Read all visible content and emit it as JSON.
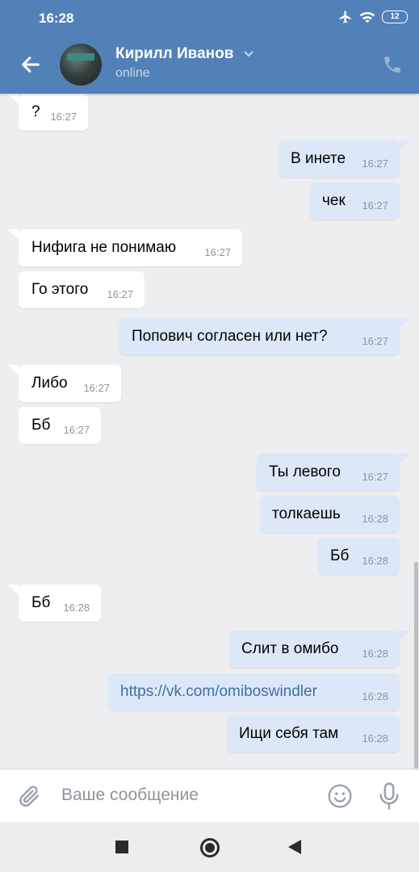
{
  "statusbar": {
    "time": "16:28",
    "battery": "12"
  },
  "header": {
    "name": "Кирилл Иванов",
    "status": "online"
  },
  "messages": [
    {
      "dir": "in",
      "text": "?",
      "time": "16:27"
    },
    {
      "dir": "out",
      "text": "В инете",
      "time": "16:27"
    },
    {
      "dir": "out",
      "text": "чек",
      "time": "16:27"
    },
    {
      "dir": "in",
      "text": "Нифига не понимаю",
      "time": "16:27"
    },
    {
      "dir": "in",
      "text": "Го этого",
      "time": "16:27"
    },
    {
      "dir": "out",
      "text": "Попович согласен или нет?",
      "time": "16:27"
    },
    {
      "dir": "in",
      "text": "Либо",
      "time": "16:27"
    },
    {
      "dir": "in",
      "text": "Бб",
      "time": "16:27"
    },
    {
      "dir": "out",
      "text": "Ты левого",
      "time": "16:27"
    },
    {
      "dir": "out",
      "text": "толкаешь",
      "time": "16:28"
    },
    {
      "dir": "out",
      "text": "Бб",
      "time": "16:28"
    },
    {
      "dir": "in",
      "text": "Бб",
      "time": "16:28"
    },
    {
      "dir": "out",
      "text": "Слит в омибо",
      "time": "16:28"
    },
    {
      "dir": "out",
      "text": "https://vk.com/omiboswindler",
      "time": "16:28",
      "link": true
    },
    {
      "dir": "out",
      "text": "Ищи себя там",
      "time": "16:28"
    }
  ],
  "composer": {
    "placeholder": "Ваше сообщение"
  },
  "colors": {
    "header": "#5181b8",
    "incoming": "#ffffff",
    "outgoing": "#dce8f7",
    "background": "#edeef0",
    "link": "#3f6f9f"
  },
  "icons": [
    "back-arrow-icon",
    "chevron-down-icon",
    "phone-icon",
    "paperclip-icon",
    "smiley-icon",
    "microphone-icon",
    "wifi-icon",
    "airplane-icon"
  ]
}
